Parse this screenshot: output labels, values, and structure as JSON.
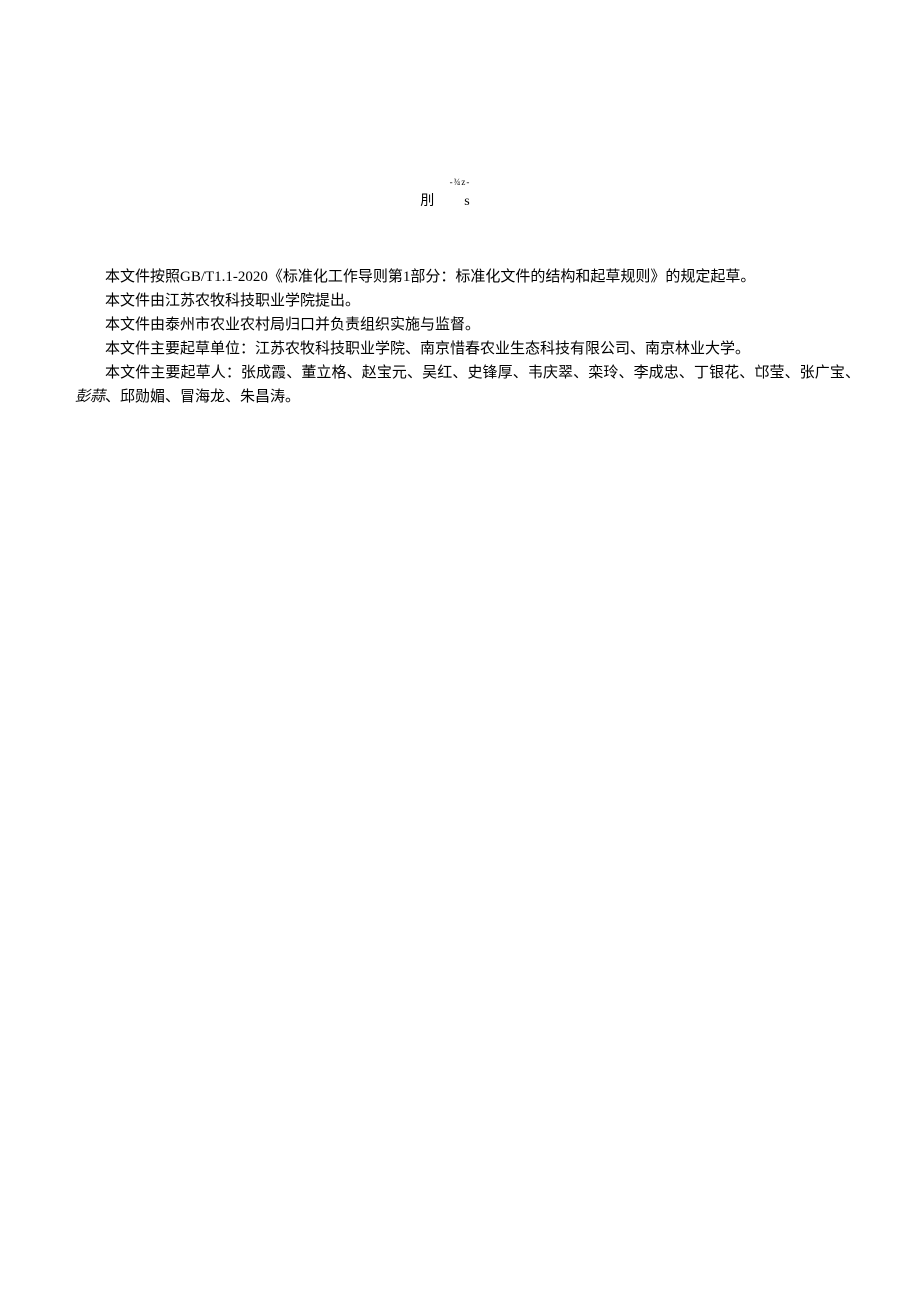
{
  "header": {
    "decoration_top": "-¾z-",
    "decoration_main_left": "刖",
    "decoration_main_right": "s"
  },
  "content": {
    "para1": "本文件按照GB/T1.1-2020《标准化工作导则第1部分：标准化文件的结构和起草规则》的规定起草。",
    "para2": "本文件由江苏农牧科技职业学院提出。",
    "para3": "本文件由泰州市农业农村局归口并负责组织实施与监督。",
    "para4": "本文件主要起草单位：江苏农牧科技职业学院、南京惜春农业生态科技有限公司、南京林业大学。",
    "para5_part1": "本文件主要起草人：张成霞、董立格、赵宝元、吴红、史锋厚、韦庆翠、栾玲、李成忠、丁银花、邙莹、张广宝、",
    "para5_italic": "彭蒜",
    "para5_part2": "、邱勋媚、冒海龙、朱昌涛。"
  }
}
